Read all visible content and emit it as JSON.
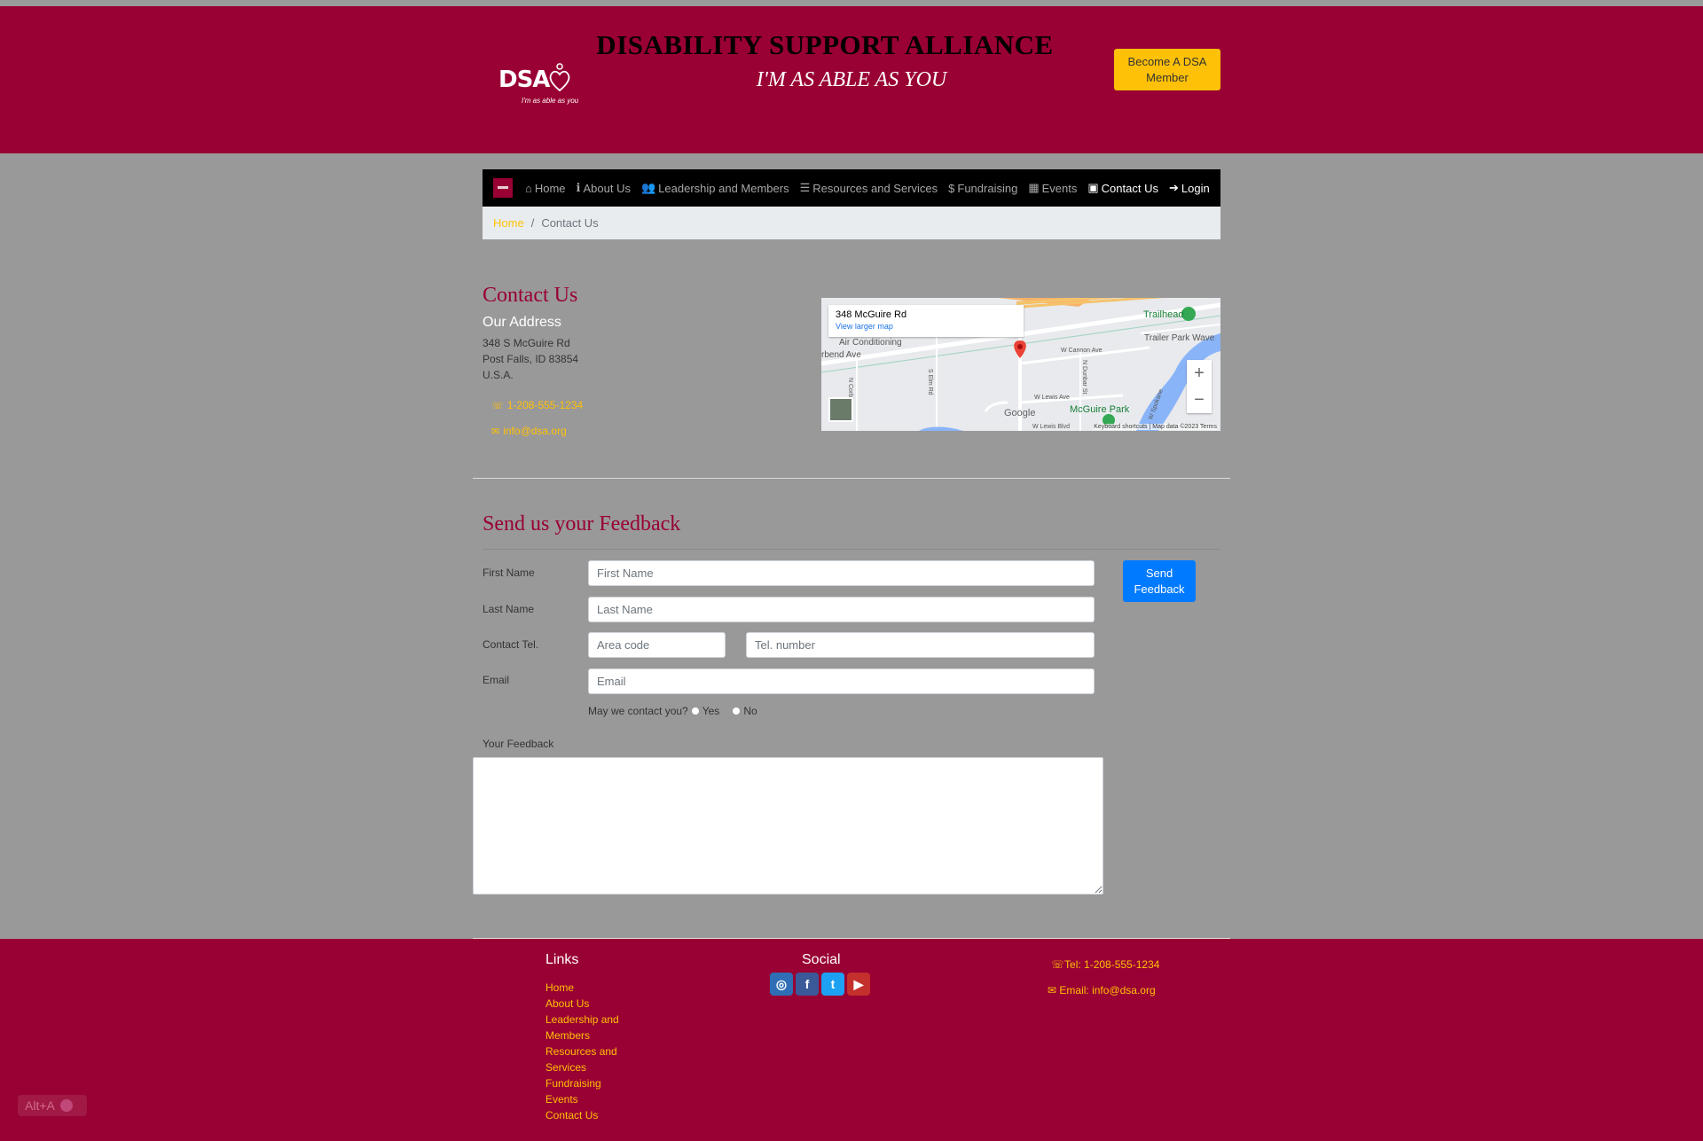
{
  "header": {
    "logo_text": "DSA",
    "logo_tagline": "I'm as able as you",
    "title": "DISABILITY SUPPORT ALLIANCE",
    "tagline": "I'M AS ABLE AS YOU",
    "member_button": "Become A DSA Member",
    "brand_color": "#990033",
    "accent_color": "#ffc107"
  },
  "nav": {
    "items": [
      {
        "label": "Home",
        "icon": "home-icon",
        "glyph": "⌂"
      },
      {
        "label": "About Us",
        "icon": "info-icon",
        "glyph": "ℹ"
      },
      {
        "label": "Leadership and Members",
        "icon": "users-icon",
        "glyph": "👥"
      },
      {
        "label": "Resources and Services",
        "icon": "list-icon",
        "glyph": "☰"
      },
      {
        "label": "Fundraising",
        "icon": "dollar-icon",
        "glyph": "$"
      },
      {
        "label": "Events",
        "icon": "calendar-icon",
        "glyph": "▦"
      },
      {
        "label": "Contact Us",
        "icon": "contact-card-icon",
        "glyph": "▣"
      },
      {
        "label": "Login",
        "icon": "login-icon",
        "glyph": "➔"
      }
    ],
    "active": "Contact Us"
  },
  "breadcrumb": {
    "home": "Home",
    "separator": "/",
    "current": "Contact Us"
  },
  "contact": {
    "title": "Contact Us",
    "address_heading": "Our Address",
    "address_line1": "348 S McGuire Rd",
    "address_line2": "Post Falls, ID 83854",
    "address_line3": "U.S.A.",
    "phone": "1-208-555-1234",
    "email": "info@dsa.org"
  },
  "map": {
    "place": "348 McGuire Rd",
    "view_larger": "View larger map",
    "labels": {
      "ac": "Air Conditioning",
      "riverbend": "rbend Ave",
      "cannon": "W Cannon Ave",
      "lewis": "W Lewis Ave",
      "trailhead": "Trailhead",
      "trailer_park": "Trailer Park Wave",
      "mcguire_park": "McGuire Park",
      "elm": "S Elm Rd",
      "dunbar": "N Dunbar St",
      "corbin": "N Corbin",
      "spokane": "W Spokane",
      "lewis_blvd": "W Lewis Blvd",
      "google": "Google",
      "footer": "Keyboard shortcuts  |  Map data ©2023   Terms"
    }
  },
  "feedback": {
    "title": "Send us your Feedback",
    "first_name_label": "First Name",
    "first_name_placeholder": "First Name",
    "last_name_label": "Last Name",
    "last_name_placeholder": "Last Name",
    "tel_label": "Contact Tel.",
    "area_placeholder": "Area code",
    "tel_placeholder": "Tel. number",
    "email_label": "Email",
    "email_placeholder": "Email",
    "may_contact": "May we contact you?",
    "yes": "Yes",
    "no": "No",
    "feedback_label": "Your Feedback",
    "send_button": "Send Feedback"
  },
  "footer": {
    "links_heading": "Links",
    "links": [
      "Home",
      "About Us",
      "Leadership and Members",
      "Resources and Services",
      "Fundraising",
      "Events",
      "Contact Us"
    ],
    "social_heading": "Social",
    "socials": [
      {
        "name": "instagram-icon",
        "color": "#2f6eb5",
        "glyph": "◎"
      },
      {
        "name": "facebook-icon",
        "color": "#3b5998",
        "glyph": "f"
      },
      {
        "name": "twitter-icon",
        "color": "#1da1f2",
        "glyph": "t"
      },
      {
        "name": "youtube-icon",
        "color": "#c4302b",
        "glyph": "▶"
      }
    ],
    "tel": "Tel: 1-208-555-1234",
    "email": "Email: info@dsa.org"
  },
  "shortcut_badge": "Alt+A"
}
